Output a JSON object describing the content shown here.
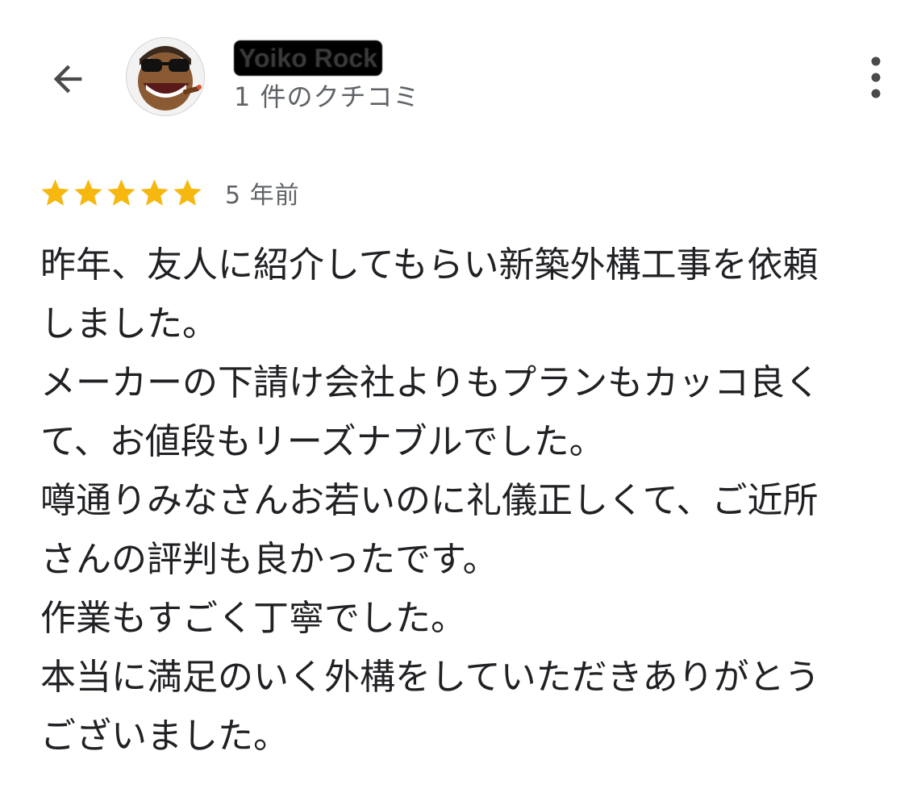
{
  "header": {
    "back_icon": "arrow-back-icon",
    "avatar_icon": "avatar-image",
    "user_name": "Yoiko Rock",
    "review_count": "1 件のクチコミ",
    "more_icon": "more-vert-icon"
  },
  "review": {
    "rating": 5,
    "rating_max": 5,
    "star_color": "#F6B70E",
    "date": "5 年前",
    "lines": [
      "昨年、友人に紹介してもらい新築外構工事を依頼",
      "しました。",
      "メーカーの下請け会社よりもプランもカッコ良く",
      "て、お値段もリーズナブルでした。",
      "噂通りみなさんお若いのに礼儀正しくて、ご近所",
      "さんの評判も良かったです。",
      "作業もすごく丁寧でした。",
      "本当に満足のいく外構をしていただきありがとう",
      "ございました。"
    ]
  }
}
